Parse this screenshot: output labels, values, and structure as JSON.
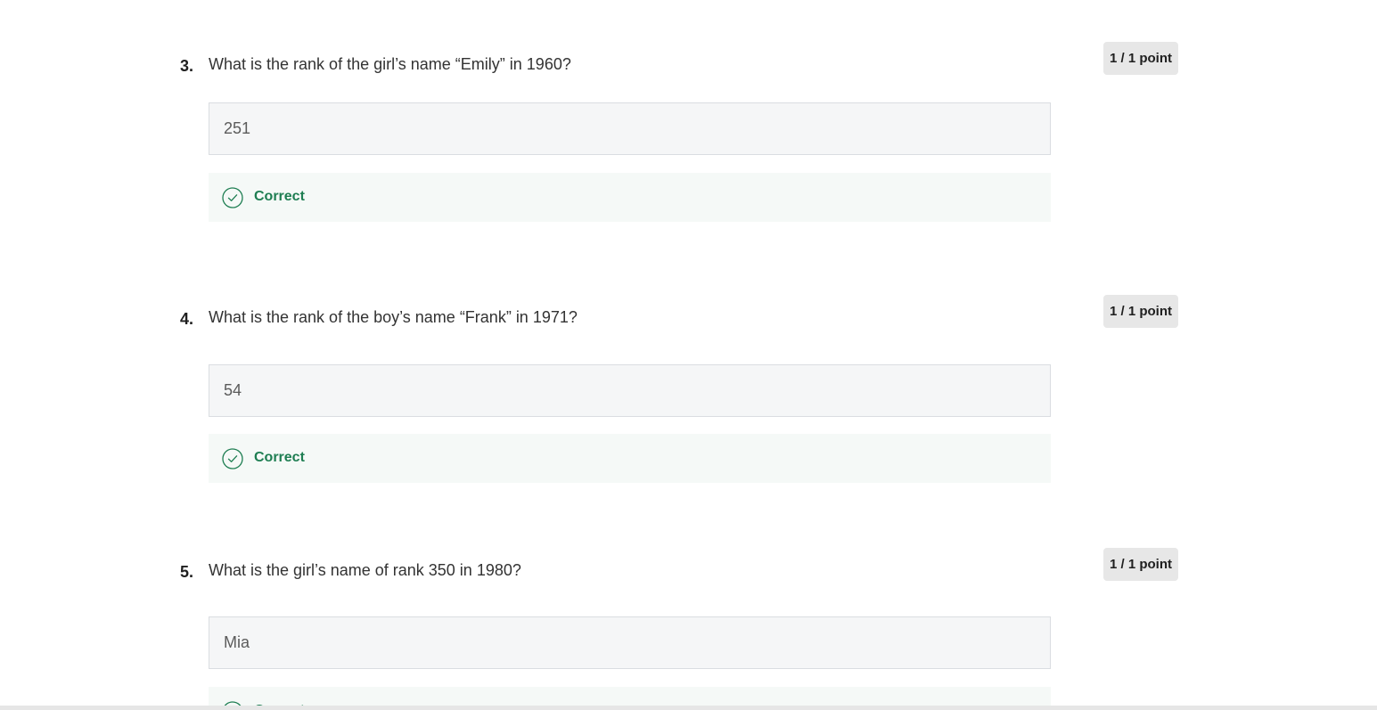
{
  "questions": [
    {
      "number": "3.",
      "text": "What is the rank of the girl’s name “Emily” in 1960?",
      "points": "1 / 1 point",
      "answer": "251",
      "feedback": "Correct"
    },
    {
      "number": "4.",
      "text": "What is the rank of the boy’s name “Frank” in 1971?",
      "points": "1 / 1 point",
      "answer": "54",
      "feedback": "Correct"
    },
    {
      "number": "5.",
      "text": "What is the girl’s name of rank 350 in 1980?",
      "points": "1 / 1 point",
      "answer": "Mia",
      "feedback": "Correct"
    }
  ],
  "icons": {
    "feedback": "check-circle-icon"
  },
  "colors": {
    "correct": "#1e7e52",
    "feedback_bg": "#f5f9f7",
    "answer_bg": "#f5f6f7",
    "points_bg": "#e7e7e7"
  }
}
